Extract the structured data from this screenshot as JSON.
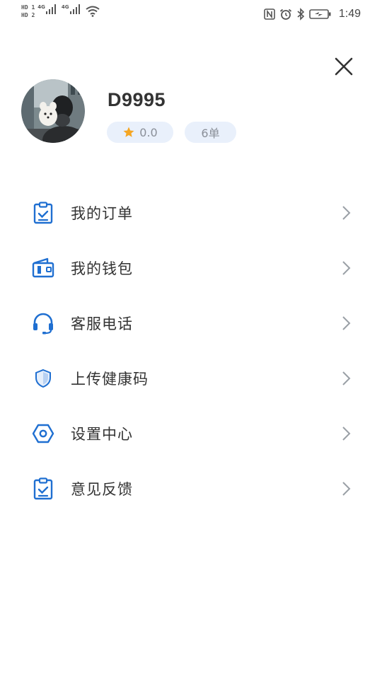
{
  "status_bar": {
    "hd1": "HD 1",
    "hd2": "HD 2",
    "net1": "4G",
    "net2": "4G",
    "time": "1:49",
    "icons": [
      "nfc-icon",
      "alarm-icon",
      "bluetooth-icon",
      "battery-icon"
    ]
  },
  "header": {
    "close_icon": "close-icon"
  },
  "profile": {
    "username": "D9995",
    "rating": "0.0",
    "orders": "6单"
  },
  "menu": {
    "items": [
      {
        "label": "我的订单",
        "icon": "clipboard-check-icon"
      },
      {
        "label": "我的钱包",
        "icon": "wallet-icon"
      },
      {
        "label": "客服电话",
        "icon": "headset-icon"
      },
      {
        "label": "上传健康码",
        "icon": "shield-icon"
      },
      {
        "label": "设置中心",
        "icon": "hexagon-settings-icon"
      },
      {
        "label": "意见反馈",
        "icon": "feedback-clipboard-icon"
      }
    ]
  },
  "colors": {
    "accent": "#1f6fd1",
    "badge_bg": "#e9f0fb",
    "star": "#f5a623",
    "text": "#333333",
    "muted": "#8a8f98"
  }
}
